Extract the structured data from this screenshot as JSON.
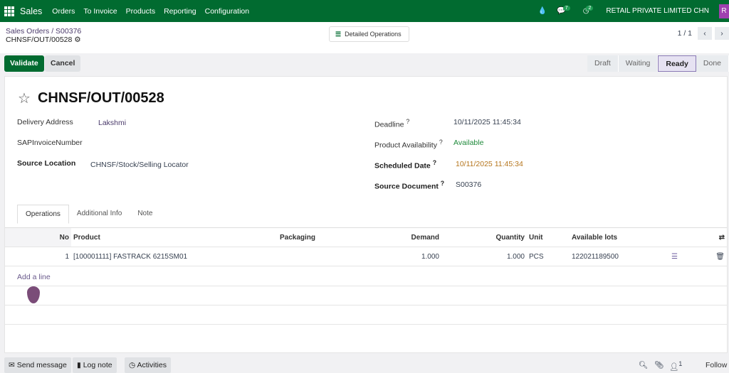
{
  "nav": {
    "brand": "Sales",
    "menus": [
      "Orders",
      "To Invoice",
      "Products",
      "Reporting",
      "Configuration"
    ],
    "messages_count": "7",
    "activities_count": "2",
    "company": "RETAIL PRIVATE LIMITED CHN",
    "avatar": "R"
  },
  "breadcrumb": {
    "parent": "Sales Orders",
    "sep": "/",
    "order": "S00376",
    "record": "CHNSF/OUT/00528"
  },
  "detailed_operations": "Detailed Operations",
  "pager": {
    "value": "1 / 1",
    "prev": "‹",
    "next": "›"
  },
  "actions": {
    "validate": "Validate",
    "cancel": "Cancel"
  },
  "statusbar": {
    "items": [
      "Draft",
      "Waiting",
      "Ready",
      "Done"
    ],
    "active": "Ready"
  },
  "form": {
    "title": "CHNSF/OUT/00528",
    "delivery_address_label": "Delivery Address",
    "delivery_address": "Lakshmi",
    "sap_label": "SAPInvoiceNumber",
    "source_location_label": "Source Location",
    "source_location": "CHNSF/Stock/Selling Locator",
    "deadline_label": "Deadline",
    "deadline": "10/11/2025 11:45:34",
    "availability_label": "Product Availability",
    "availability": "Available",
    "scheduled_label": "Scheduled Date",
    "scheduled": "10/11/2025 11:45:34",
    "source_doc_label": "Source Document",
    "source_doc": "S00376",
    "help": "?"
  },
  "tabs": [
    "Operations",
    "Additional Info",
    "Note"
  ],
  "table": {
    "headers": [
      "No",
      "Product",
      "Packaging",
      "Demand",
      "Quantity",
      "Unit",
      "Available lots"
    ],
    "rows": [
      {
        "no": "1",
        "product": "[100001111] FASTRACK 6215SM01",
        "packaging": "",
        "demand": "1.000",
        "quantity": "1.000",
        "unit": "PCS",
        "lots": "122021189500"
      }
    ],
    "add_line": "Add a line"
  },
  "chatter": {
    "send": "Send message",
    "log": "Log note",
    "activities": "Activities",
    "followers": "1",
    "follow": "Follow"
  },
  "colors": {
    "navbar": "#016b30",
    "primary": "#016b30",
    "available": "#1f8a3b",
    "scheduled": "#b5751c"
  }
}
